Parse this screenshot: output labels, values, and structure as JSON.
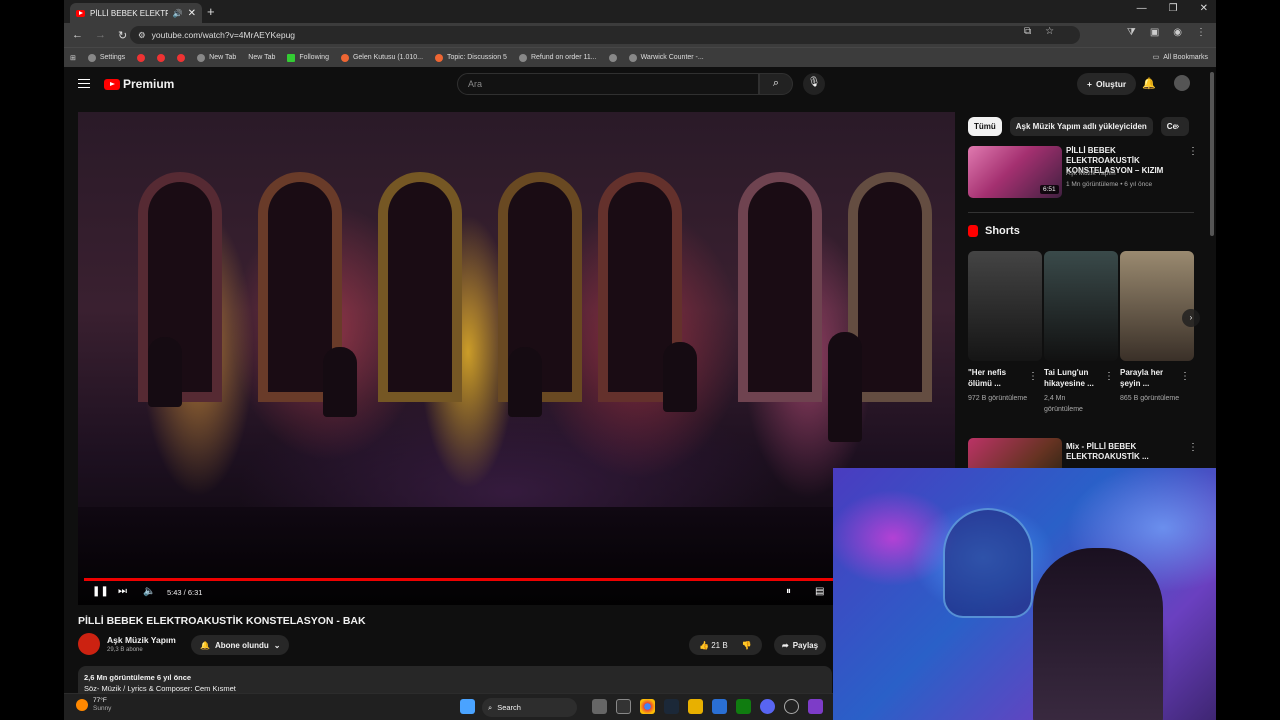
{
  "browser": {
    "tab_title": "PİLLİ BEBEK ELEKTROAKUSTİ",
    "url": "youtube.com/watch?v=4MrAEYKepug",
    "bookmarks": [
      {
        "label": "Settings"
      },
      {
        "label": ""
      },
      {
        "label": ""
      },
      {
        "label": ""
      },
      {
        "label": "New Tab"
      },
      {
        "label": "New Tab"
      },
      {
        "label": "Following"
      },
      {
        "label": "Gelen Kutusu (1.010..."
      },
      {
        "label": "Topic: Discussion 5"
      },
      {
        "label": "Refund on order 11..."
      },
      {
        "label": ""
      },
      {
        "label": "Warwick Counter -..."
      }
    ],
    "all_bookmarks": "All Bookmarks"
  },
  "youtube": {
    "logo": "Premium",
    "search_placeholder": "Ara",
    "create_label": "Oluştur"
  },
  "player": {
    "time": "5:43 / 6:31",
    "progress": 0.876
  },
  "video": {
    "title": "PİLLİ BEBEK ELEKTROAKUSTİK KONSTELASYON - BAK",
    "channel": "Aşk Müzik Yapım",
    "subscribers": "29,3 B abone",
    "subscribe_label": "Abone olundu",
    "likes": "21 B",
    "share_label": "Paylaş",
    "views_date": "2,6 Mn görüntüleme  6 yıl önce",
    "description": "Söz- Müzik / Lyrics & Composer: Cem Kısmet"
  },
  "sidebar": {
    "chips": [
      "Tümü",
      "Aşk Müzik Yapım adlı yükleyiciden",
      "Ce"
    ],
    "rec1": {
      "title": "PİLLİ BEBEK ELEKTROAKUSTİK KONSTELASYON – KIZIM",
      "channel": "Aşk Müzik Yapım",
      "meta": "1 Mn görüntüleme • 6 yıl önce",
      "duration": "6:51"
    },
    "shorts_heading": "Shorts",
    "shorts": [
      {
        "title": "\"Her nefis ölümü ...",
        "views": "972 B görüntüleme",
        "color": "#2a2a2a"
      },
      {
        "title": "Tai Lung'un hikayesine ...",
        "views": "2,4 Mn görüntüleme",
        "color": "#1e2a2a"
      },
      {
        "title": "Parayla her şeyin ...",
        "views": "865 B görüntüleme",
        "color": "#7a6a5a"
      }
    ],
    "rec2": {
      "title": "Mix - PİLLİ BEBEK ELEKTROAKUSTİK ..."
    }
  },
  "taskbar": {
    "temp": "77°F",
    "condition": "Sunny",
    "search": "Search"
  }
}
